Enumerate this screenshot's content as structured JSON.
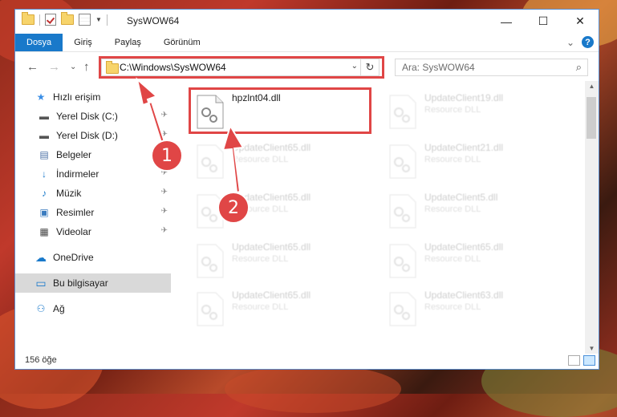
{
  "window": {
    "title": "SysWOW64",
    "controls": {
      "minimize": "—",
      "maximize": "☐",
      "close": "✕"
    }
  },
  "ribbon": {
    "tabs": [
      {
        "label": "Dosya"
      },
      {
        "label": "Giriş"
      },
      {
        "label": "Paylaş"
      },
      {
        "label": "Görünüm"
      }
    ],
    "expand_glyph": "⌄",
    "help_glyph": "?"
  },
  "navigation": {
    "back": "←",
    "forward": "→",
    "recent": "⌄",
    "up": "↑"
  },
  "address": {
    "path": "C:\\Windows\\SysWOW64",
    "refresh": "↻",
    "dropdown": "⌄"
  },
  "search": {
    "placeholder": "Ara: SysWOW64",
    "icon": "⌕"
  },
  "sidebar": {
    "items": [
      {
        "label": "Hızlı erişim",
        "icon": "star-icon",
        "glyph": "★",
        "color": "#3a8ee6"
      },
      {
        "label": "Yerel Disk (C:)",
        "icon": "drive-icon",
        "glyph": "▬",
        "color": "#555555",
        "pinned": true
      },
      {
        "label": "Yerel Disk (D:)",
        "icon": "drive-icon",
        "glyph": "▬",
        "color": "#555555",
        "pinned": true
      },
      {
        "label": "Belgeler",
        "icon": "document-icon",
        "glyph": "▤",
        "color": "#4a6fa5",
        "pinned": true
      },
      {
        "label": "İndirmeler",
        "icon": "download-icon",
        "glyph": "↓",
        "color": "#1979ca",
        "pinned": true
      },
      {
        "label": "Müzik",
        "icon": "music-icon",
        "glyph": "♪",
        "color": "#1979ca",
        "pinned": true
      },
      {
        "label": "Resimler",
        "icon": "pictures-icon",
        "glyph": "▣",
        "color": "#3a7bbf",
        "pinned": true
      },
      {
        "label": "Videolar",
        "icon": "video-icon",
        "glyph": "▦",
        "color": "#444444",
        "pinned": true
      },
      {
        "label": "OneDrive",
        "icon": "cloud-icon",
        "glyph": "☁",
        "color": "#1979ca"
      },
      {
        "label": "Bu bilgisayar",
        "icon": "computer-icon",
        "glyph": "▭",
        "color": "#1979ca"
      },
      {
        "label": "Ağ",
        "icon": "network-icon",
        "glyph": "⚇",
        "color": "#1979ca"
      }
    ],
    "pin_glyph": "📌"
  },
  "files": [
    {
      "name": "hpzlnt04.dll",
      "type": "",
      "highlighted": true
    },
    {
      "name": "UpdateClient19.dll",
      "type": "Resource DLL"
    },
    {
      "name": "UpdateClient65.dll",
      "type": "Resource DLL"
    },
    {
      "name": "UpdateClient21.dll",
      "type": "Resource DLL"
    },
    {
      "name": "UpdateClient65.dll",
      "type": "Resource DLL"
    },
    {
      "name": "UpdateClient5.dll",
      "type": "Resource DLL"
    },
    {
      "name": "UpdateClient65.dll",
      "type": "Resource DLL"
    },
    {
      "name": "UpdateClient65.dll",
      "type": "Resource DLL"
    },
    {
      "name": "UpdateClient65.dll",
      "type": "Resource DLL"
    },
    {
      "name": "UpdateClient63.dll",
      "type": "Resource DLL"
    }
  ],
  "status": {
    "item_count": "156 öğe"
  },
  "callouts": [
    {
      "number": "1"
    },
    {
      "number": "2"
    }
  ],
  "colors": {
    "accent": "#1979ca",
    "highlight": "#e04646",
    "selection": "#cce8ff"
  }
}
